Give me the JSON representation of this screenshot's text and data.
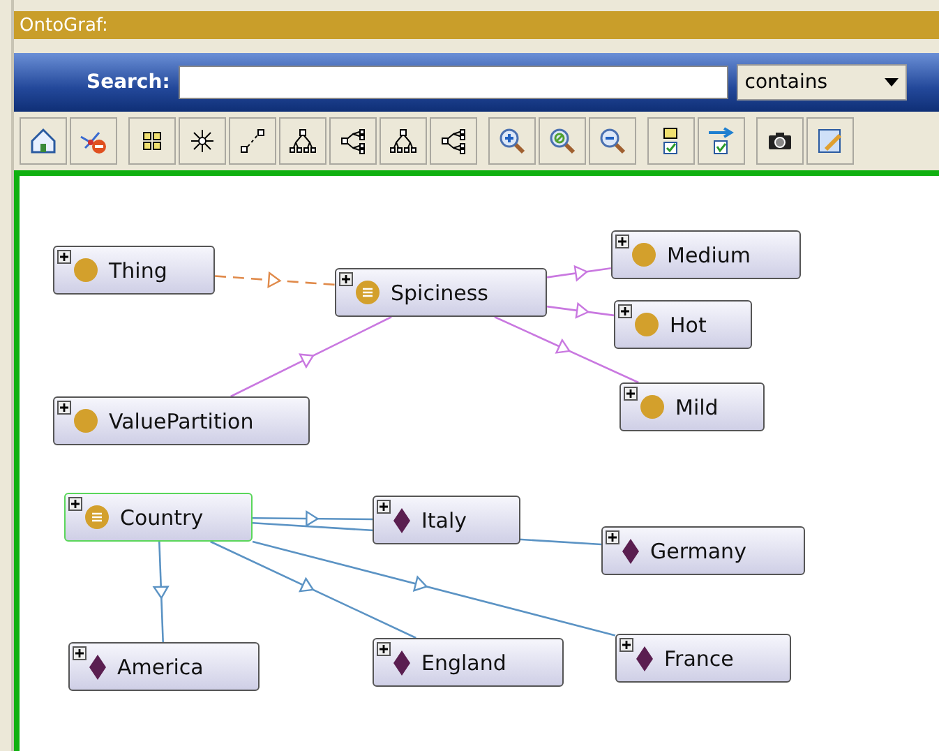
{
  "window": {
    "title": "OntoGraf:"
  },
  "search": {
    "label": "Search:",
    "mode": "contains"
  },
  "graph": {
    "nodes": [
      {
        "label": "Thing",
        "kind": "class",
        "selected": false
      },
      {
        "label": "Spiciness",
        "kind": "defined",
        "selected": false
      },
      {
        "label": "Medium",
        "kind": "class",
        "selected": false
      },
      {
        "label": "Hot",
        "kind": "class",
        "selected": false
      },
      {
        "label": "Mild",
        "kind": "class",
        "selected": false
      },
      {
        "label": "ValuePartition",
        "kind": "class",
        "selected": false
      },
      {
        "label": "Country",
        "kind": "defined",
        "selected": true
      },
      {
        "label": "Italy",
        "kind": "individual",
        "selected": false
      },
      {
        "label": "Germany",
        "kind": "individual",
        "selected": false
      },
      {
        "label": "America",
        "kind": "individual",
        "selected": false
      },
      {
        "label": "England",
        "kind": "individual",
        "selected": false
      },
      {
        "label": "France",
        "kind": "individual",
        "selected": false
      }
    ],
    "edges": [
      {
        "kind": "equivalent"
      },
      {
        "kind": "subclass"
      },
      {
        "kind": "subclass"
      },
      {
        "kind": "subclass"
      },
      {
        "kind": "subclass"
      },
      {
        "kind": "instance"
      },
      {
        "kind": "instance"
      },
      {
        "kind": "instance"
      },
      {
        "kind": "instance"
      },
      {
        "kind": "instance"
      }
    ]
  }
}
